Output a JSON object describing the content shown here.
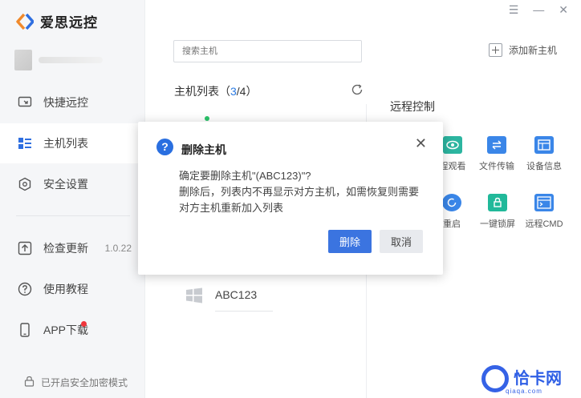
{
  "app": {
    "title": "爱思远控"
  },
  "sidebar": {
    "items": [
      {
        "label": "快捷远控",
        "icon": "remote-screen-icon"
      },
      {
        "label": "主机列表",
        "icon": "host-list-icon",
        "active": true
      },
      {
        "label": "安全设置",
        "icon": "shield-icon"
      },
      {
        "label": "检查更新",
        "icon": "update-icon",
        "version": "1.0.22"
      },
      {
        "label": "使用教程",
        "icon": "help-icon"
      },
      {
        "label": "APP下载",
        "icon": "phone-icon"
      }
    ],
    "secure_mode": "已开启安全加密模式"
  },
  "window_controls": {
    "menu": "☰",
    "minimize": "—",
    "close": "✕"
  },
  "search": {
    "placeholder": "搜索主机"
  },
  "add_host": {
    "label": "添加新主机"
  },
  "host_list": {
    "title_prefix": "主机列表（",
    "current": "3",
    "sep": "/4",
    "title_suffix": "）"
  },
  "remote_control": {
    "title": "远程控制",
    "tools": [
      {
        "label": "程观看",
        "icon": "eye-icon",
        "color": "#2cb5a0"
      },
      {
        "label": "文件传输",
        "icon": "file-transfer-icon",
        "color": "#3a86e8"
      },
      {
        "label": "设备信息",
        "icon": "device-info-icon",
        "color": "#3a86e8"
      },
      {
        "label": "重启",
        "icon": "restart-icon",
        "color": "#3a86e8"
      },
      {
        "label": "一键锁屏",
        "icon": "lock-screen-icon",
        "color": "#21b99a"
      },
      {
        "label": "远程CMD",
        "icon": "cmd-icon",
        "color": "#3a86e8"
      }
    ]
  },
  "host": {
    "name": "ABC123"
  },
  "dialog": {
    "title": "删除主机",
    "line1": "确定要删除主机\"(ABC123)\"?",
    "line2": "删除后，列表内不再显示对方主机，如需恢复则需要",
    "line3": "对方主机重新加入列表",
    "confirm": "删除",
    "cancel": "取消",
    "close": "✕"
  },
  "watermark": {
    "text": "恰卡网",
    "sub": "qiaqa.com"
  },
  "colors": {
    "accent": "#3b74e0",
    "online": "#2bc46a",
    "badge": "#f0353b"
  }
}
